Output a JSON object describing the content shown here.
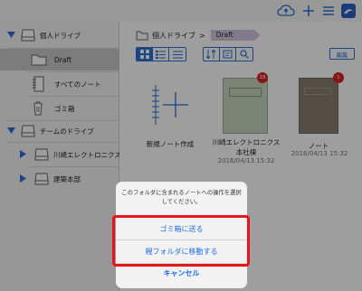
{
  "toolbar": {
    "icons": [
      "cloud-sync-icon",
      "plus-icon",
      "menu-icon",
      "app-logo-icon"
    ]
  },
  "sidebar": {
    "sections": [
      {
        "label": "個人ドライブ",
        "icon": "drive-icon"
      },
      {
        "label": "チームのドライブ",
        "icon": "drive-icon"
      }
    ],
    "items": [
      {
        "label": "Draft",
        "icon": "folder-icon"
      },
      {
        "label": "すべてのノート",
        "icon": "notebook-icon"
      },
      {
        "label": "ゴミ箱",
        "icon": "trash-icon"
      },
      {
        "label": "川崎エレクトロニクス",
        "icon": "drive-icon"
      },
      {
        "label": "建築本部",
        "icon": "drive-icon"
      }
    ]
  },
  "breadcrumb": {
    "root": "個人ドライブ",
    "separator": ">",
    "current": "Draft"
  },
  "view_toggles": [
    "grid-view-icon",
    "list-view-icon",
    "detail-list-icon"
  ],
  "action_icons": [
    "sort-icon",
    "label-icon",
    "search-icon"
  ],
  "edit_label": "編集",
  "notebooks": [
    {
      "title": "新規ノート作成",
      "line2": "",
      "date": ""
    },
    {
      "title": "川崎エレクトロニクス",
      "line2": "本社棟",
      "date": "2016/04/13 15:32",
      "badge": "18",
      "cover_color": "#c9d6c2"
    },
    {
      "title": "ノート",
      "line2": "",
      "date": "2016/04/13 15:32",
      "badge": "1",
      "cover_color": "#8a7f73"
    }
  ],
  "action_sheet": {
    "message": "このフォルダに含まれるノートへの操作を選択してください。",
    "buttons": [
      "ゴミ箱に送る",
      "親フォルダに移動する",
      "キャンセル"
    ]
  },
  "colors": {
    "accent": "#2a6fd6",
    "badge": "#d92525",
    "highlight": "#e8151a",
    "tag": "#cfc6e0"
  }
}
